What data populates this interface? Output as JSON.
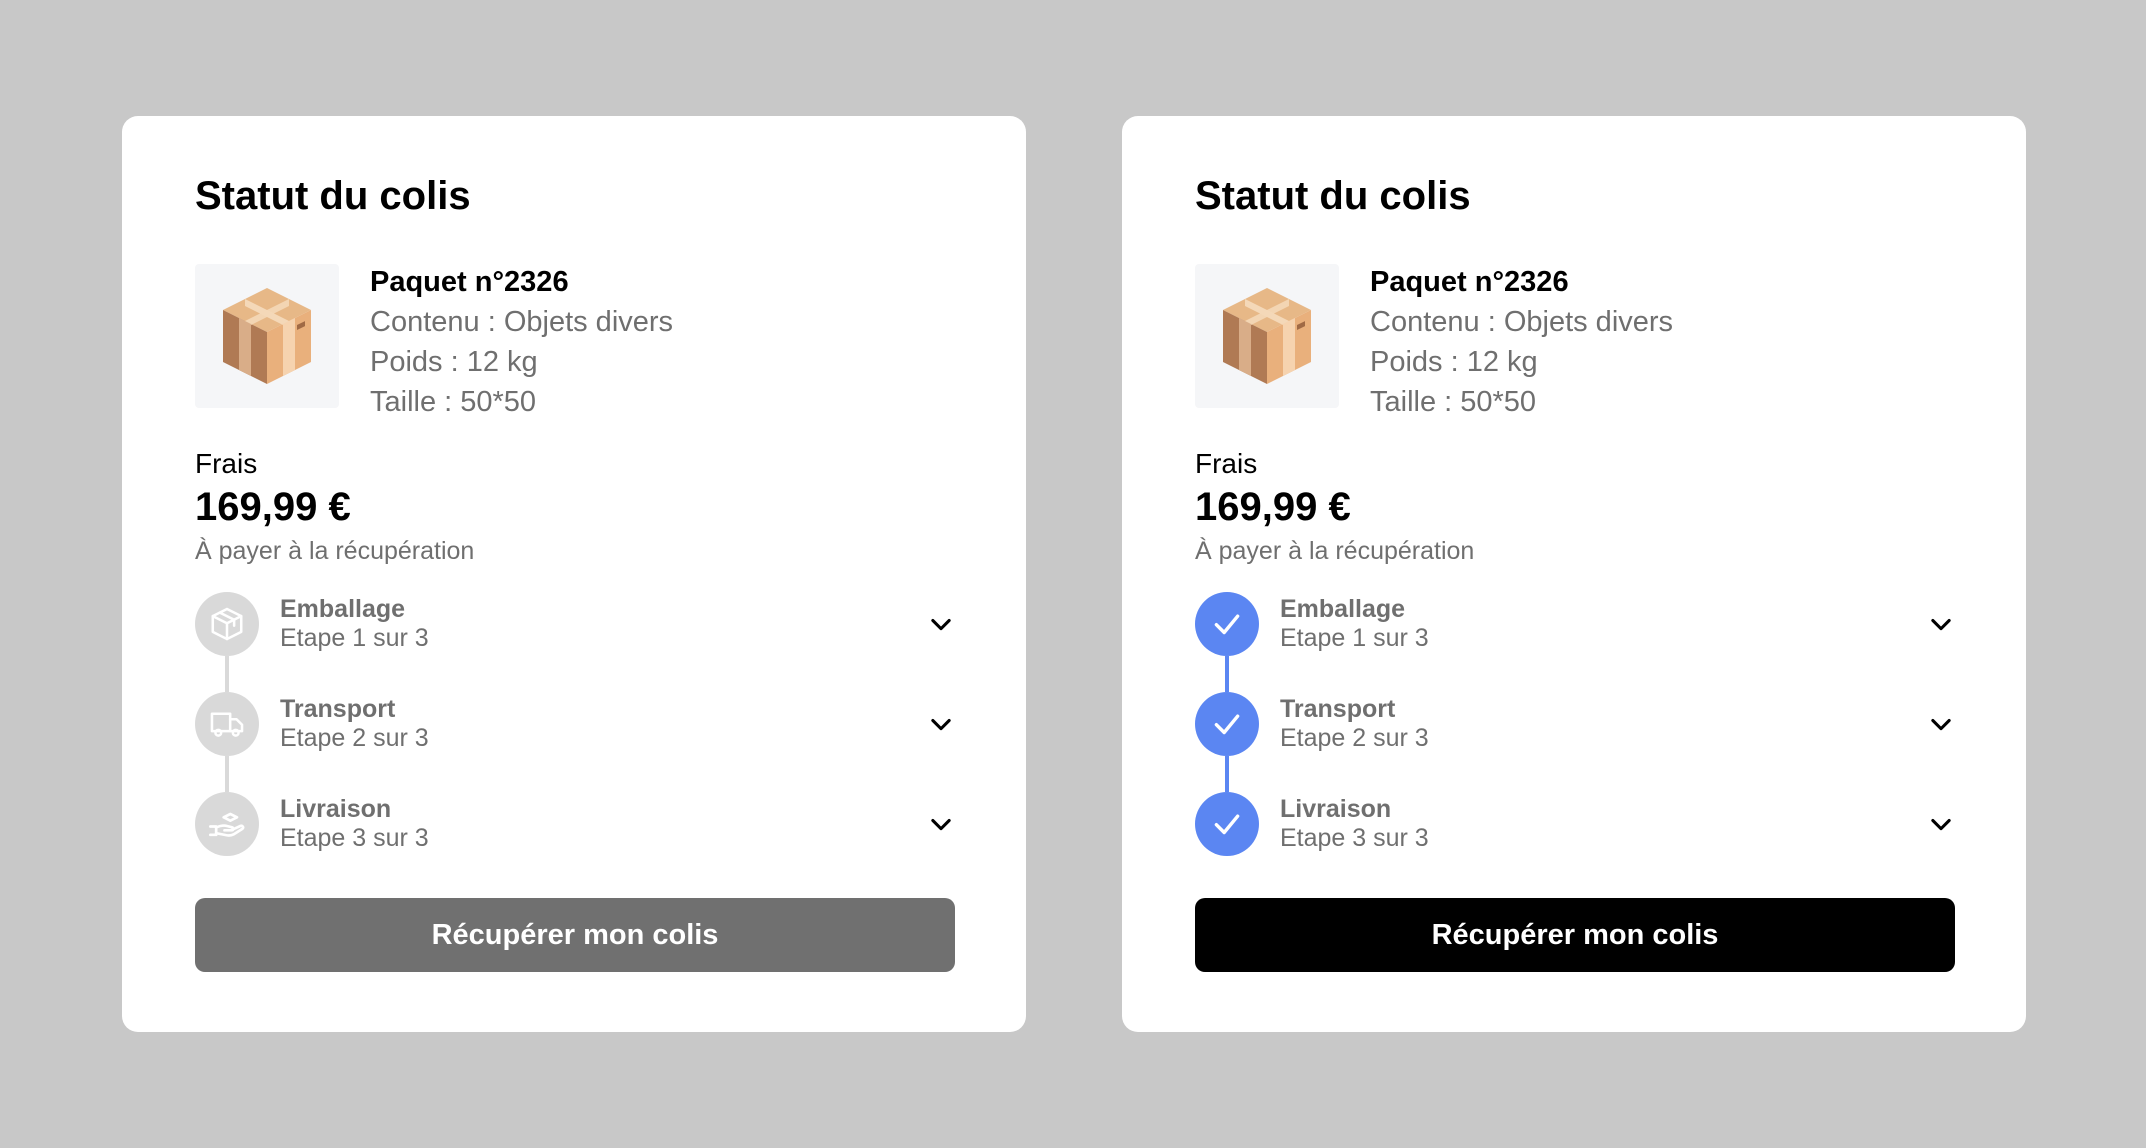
{
  "colors": {
    "background": "#c8c8c8",
    "card": "#ffffff",
    "inactive_step": "#d9d9d9",
    "inactive_step_icon": "#ffffff",
    "active_step": "#5b86f2",
    "button_disabled": "#707070",
    "button_enabled": "#000000",
    "muted_text": "#6f6f6f"
  },
  "cards": [
    {
      "state": "pending",
      "title": "Statut du colis",
      "package": {
        "image_icon": "cardboard-box-icon",
        "name": "Paquet n°2326",
        "content": "Contenu : Objets divers",
        "weight": "Poids : 12 kg",
        "size": "Taille : 50*50"
      },
      "fees": {
        "label": "Frais",
        "amount": "169,99 €",
        "note": "À payer à la récupération"
      },
      "steps": [
        {
          "title": "Emballage",
          "subtitle": "Etape 1 sur 3",
          "icon": "box-icon",
          "completed": false
        },
        {
          "title": "Transport",
          "subtitle": "Etape 2 sur 3",
          "icon": "truck-icon",
          "completed": false
        },
        {
          "title": "Livraison",
          "subtitle": "Etape 3 sur 3",
          "icon": "hand-delivery-icon",
          "completed": false
        }
      ],
      "button_label": "Récupérer mon colis"
    },
    {
      "state": "completed",
      "title": "Statut du colis",
      "package": {
        "image_icon": "cardboard-box-icon",
        "name": "Paquet n°2326",
        "content": "Contenu : Objets divers",
        "weight": "Poids : 12 kg",
        "size": "Taille : 50*50"
      },
      "fees": {
        "label": "Frais",
        "amount": "169,99 €",
        "note": "À payer à la récupération"
      },
      "steps": [
        {
          "title": "Emballage",
          "subtitle": "Etape 1 sur 3",
          "icon": "check-icon",
          "completed": true
        },
        {
          "title": "Transport",
          "subtitle": "Etape 2 sur 3",
          "icon": "check-icon",
          "completed": true
        },
        {
          "title": "Livraison",
          "subtitle": "Etape 3 sur 3",
          "icon": "check-icon",
          "completed": true
        }
      ],
      "button_label": "Récupérer mon colis"
    }
  ]
}
